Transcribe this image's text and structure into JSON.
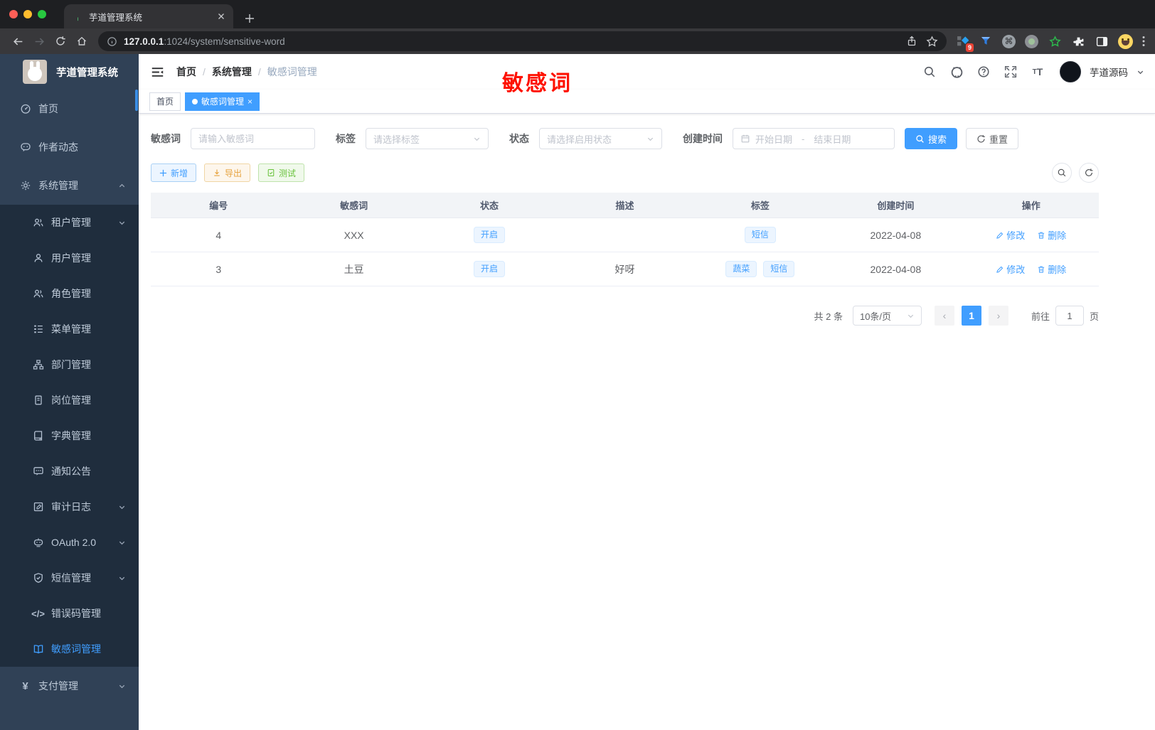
{
  "browser": {
    "tab_title": "芋道管理系统",
    "url_host": "127.0.0.1",
    "url_path": ":1024/system/sensitive-word",
    "extension_badge": "9",
    "command_glyph": "⌘",
    "icons": [
      "back-icon",
      "forward-icon",
      "reload-icon",
      "home-icon",
      "info-icon",
      "share-icon",
      "bookmark-star-icon",
      "extension-grid-icon",
      "funnel-icon",
      "command-icon",
      "recorder-icon",
      "green-star-icon",
      "puzzle-icon",
      "sidebar-panel-icon",
      "emoji-avatar",
      "kebab-menu-icon"
    ]
  },
  "sidebar": {
    "app_title": "芋道管理系统",
    "items": [
      {
        "label": "首页",
        "icon": "gauge-icon"
      },
      {
        "label": "作者动态",
        "icon": "chat-face-icon"
      },
      {
        "label": "系统管理",
        "icon": "gear-icon",
        "caret": "up"
      },
      {
        "label": "租户管理",
        "icon": "users-icon",
        "caret": "down"
      },
      {
        "label": "用户管理",
        "icon": "user-icon"
      },
      {
        "label": "角色管理",
        "icon": "role-users-icon"
      },
      {
        "label": "菜单管理",
        "icon": "menu-tree-icon"
      },
      {
        "label": "部门管理",
        "icon": "org-chart-icon"
      },
      {
        "label": "岗位管理",
        "icon": "post-badge-icon"
      },
      {
        "label": "字典管理",
        "icon": "dictionary-icon"
      },
      {
        "label": "通知公告",
        "icon": "announcement-icon"
      },
      {
        "label": "审计日志",
        "icon": "audit-log-icon",
        "caret": "down"
      },
      {
        "label": "OAuth 2.0",
        "icon": "robot-icon",
        "caret": "down"
      },
      {
        "label": "短信管理",
        "icon": "shield-check-icon",
        "caret": "down"
      },
      {
        "label": "错误码管理",
        "icon": "code-icon",
        "glyph": "</>"
      },
      {
        "label": "敏感词管理",
        "icon": "open-book-icon",
        "active": true
      },
      {
        "label": "支付管理",
        "icon": "yen-icon",
        "glyph": "¥",
        "caret": "down"
      }
    ]
  },
  "navbar": {
    "breadcrumb": [
      "首页",
      "系统管理",
      "敏感词管理"
    ],
    "separator": "/",
    "username": "芋道源码",
    "icons": [
      "search-icon",
      "github-icon",
      "help-icon",
      "fullscreen-icon",
      "font-size-icon"
    ]
  },
  "annotation": {
    "text": "敏感词",
    "color": "#fe1100"
  },
  "tab_bar": {
    "tabs": [
      {
        "label": "首页",
        "active": false
      },
      {
        "label": "敏感词管理",
        "active": true
      }
    ]
  },
  "filters": {
    "keyword_label": "敏感词",
    "keyword_placeholder": "请输入敏感词",
    "tag_label": "标签",
    "tag_placeholder": "请选择标签",
    "status_label": "状态",
    "status_placeholder": "请选择启用状态",
    "time_label": "创建时间",
    "time_start_placeholder": "开始日期",
    "time_separator": "-",
    "time_end_placeholder": "结束日期",
    "search_label": "搜索",
    "reset_label": "重置"
  },
  "toolbar": {
    "add_label": "新增",
    "export_label": "导出",
    "test_label": "测试"
  },
  "table": {
    "columns": [
      "编号",
      "敏感词",
      "状态",
      "描述",
      "标签",
      "创建时间",
      "操作"
    ],
    "edit_label": "修改",
    "delete_label": "删除",
    "rows": [
      {
        "id": "4",
        "word": "XXX",
        "status": "开启",
        "description": "",
        "tags": [
          "短信"
        ],
        "create_time": "2022-04-08"
      },
      {
        "id": "3",
        "word": "土豆",
        "status": "开启",
        "description": "好呀",
        "tags": [
          "蔬菜",
          "短信"
        ],
        "create_time": "2022-04-08"
      }
    ]
  },
  "pagination": {
    "total": "共 2 条",
    "page_size": "10条/页",
    "prev": "‹",
    "current": "1",
    "next": "›",
    "goto_label": "前往",
    "goto_value": "1",
    "unit_label": "页"
  },
  "colors": {
    "accent": "#409eff",
    "sidebar_bg": "#304156",
    "submenu_bg": "#1f2d3d",
    "warning": "#e6a23c",
    "success": "#67c23a",
    "annotation_red": "#fe1100",
    "tag_bg": "#ecf5ff",
    "tag_border": "#d9ecff"
  }
}
